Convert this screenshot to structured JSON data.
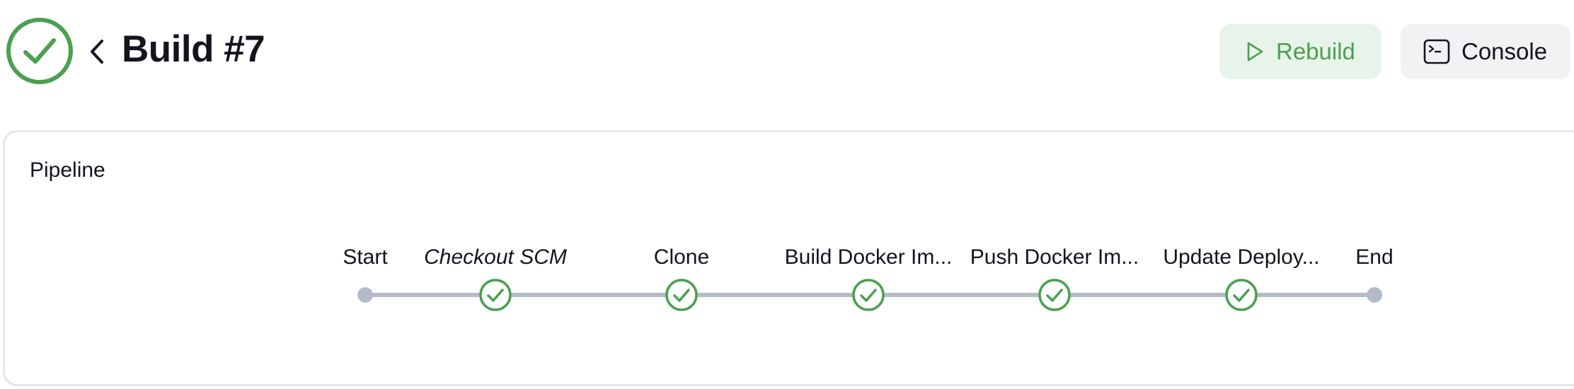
{
  "header": {
    "title": "Build #7",
    "status": "success",
    "status_color": "#4aa04f"
  },
  "toolbar": {
    "rebuild_label": "Rebuild",
    "rebuild_icon": "play-icon",
    "console_label": "Console",
    "console_icon": "terminal-icon"
  },
  "pipeline": {
    "title": "Pipeline",
    "line_color": "#b3bbc7",
    "stages": [
      {
        "label": "Start",
        "kind": "endpoint"
      },
      {
        "label": "Checkout SCM",
        "kind": "stage",
        "status": "success",
        "italic": true
      },
      {
        "label": "Clone",
        "kind": "stage",
        "status": "success"
      },
      {
        "label": "Build Docker Im...",
        "kind": "stage",
        "status": "success"
      },
      {
        "label": "Push Docker Im...",
        "kind": "stage",
        "status": "success"
      },
      {
        "label": "Update Deploy...",
        "kind": "stage",
        "status": "success"
      },
      {
        "label": "End",
        "kind": "endpoint"
      }
    ]
  }
}
